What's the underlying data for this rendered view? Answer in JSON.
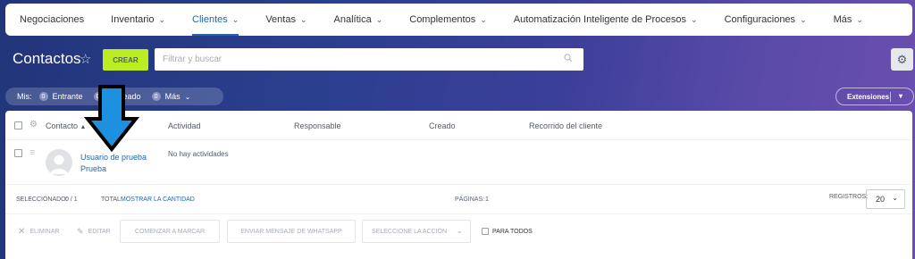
{
  "nav": {
    "items": [
      {
        "label": "Negociaciones",
        "dropdown": false,
        "active": false
      },
      {
        "label": "Inventario",
        "dropdown": true,
        "active": false
      },
      {
        "label": "Clientes",
        "dropdown": true,
        "active": true
      },
      {
        "label": "Ventas",
        "dropdown": true,
        "active": false
      },
      {
        "label": "Analítica",
        "dropdown": true,
        "active": false
      },
      {
        "label": "Complementos",
        "dropdown": true,
        "active": false
      },
      {
        "label": "Automatización Inteligente de Procesos",
        "dropdown": true,
        "active": false
      },
      {
        "label": "Configuraciones",
        "dropdown": true,
        "active": false
      },
      {
        "label": "Más",
        "dropdown": true,
        "active": false
      }
    ]
  },
  "toolbar": {
    "title": "Contactos",
    "create_label": "CREAR",
    "search_placeholder": "Filtrar y buscar"
  },
  "counters": {
    "label": "Mis:",
    "items": [
      {
        "count": "0",
        "label": "Entrante"
      },
      {
        "count": "0",
        "label": "Planeado"
      },
      {
        "count": "0",
        "label": "Más"
      }
    ]
  },
  "extensions_label": "Extensiones",
  "table": {
    "columns": [
      "Contacto",
      "Actividad",
      "Responsable",
      "Creado",
      "Recorrido del cliente"
    ],
    "rows": [
      {
        "name": "Usuario de prueba",
        "company": "Prueba",
        "activity": "No hay actividades"
      }
    ]
  },
  "footer": {
    "selected_label": "SELECCIONADO:",
    "selected_value": "0 / 1",
    "total_label": "TOTAL:",
    "total_link": "MOSTRAR LA CANTIDAD",
    "pages_label": "PÁGINAS:",
    "pages_value": "1",
    "records_label": "REGISTROS:",
    "records_value": "20"
  },
  "actions": {
    "delete": "ELIMINAR",
    "edit": "EDITAR",
    "start_dial": "COMENZAR A MARCAR",
    "whatsapp": "ENVIAR MENSAJE DE WHATSAPP",
    "select_action": "SELECCIONE LA ACCIÓN",
    "for_all": "PARA TODOS"
  },
  "colors": {
    "accent": "#2067b0",
    "create_button": "#bbed21",
    "annotation_arrow": "#1e90e0"
  }
}
